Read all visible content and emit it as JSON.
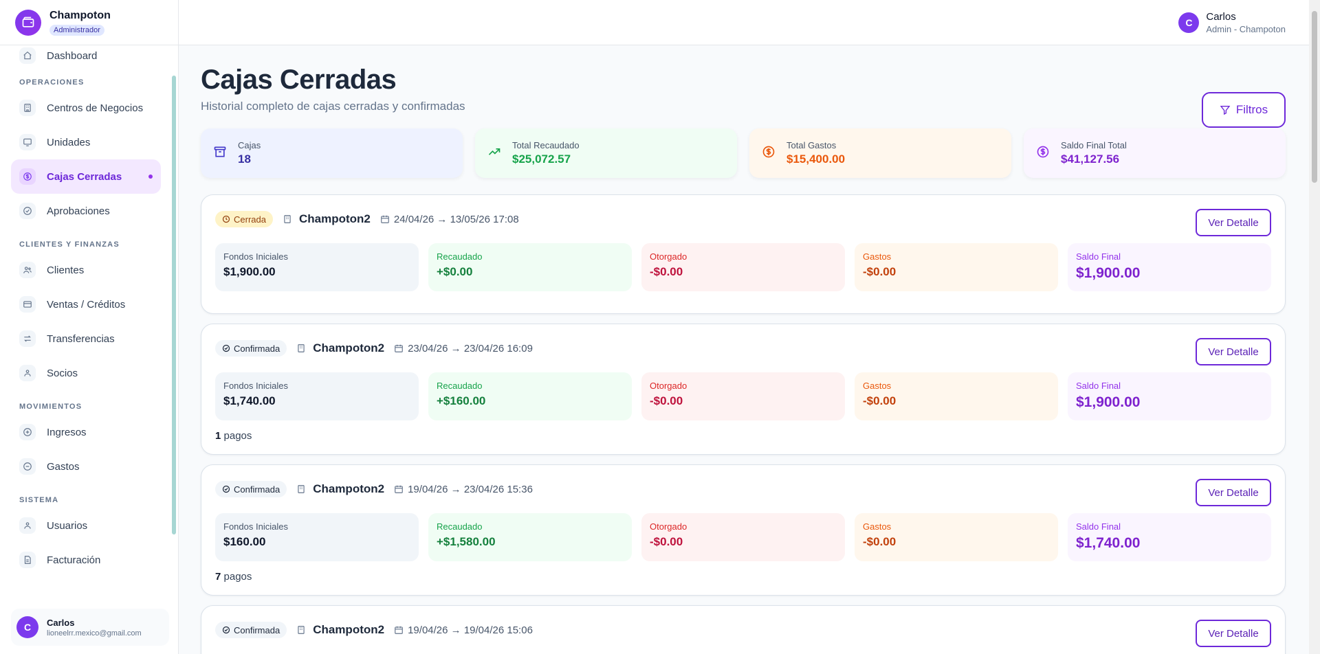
{
  "brand": {
    "name": "Champoton",
    "role": "Administrador"
  },
  "nav": {
    "dashboard": "Dashboard",
    "section_operaciones": "OPERACIONES",
    "centros": "Centros de Negocios",
    "unidades": "Unidades",
    "cajas": "Cajas Cerradas",
    "aprobaciones": "Aprobaciones",
    "section_clientes": "CLIENTES Y FINANZAS",
    "clientes": "Clientes",
    "ventas": "Ventas / Créditos",
    "transferencias": "Transferencias",
    "socios": "Socios",
    "section_movimientos": "MOVIMIENTOS",
    "ingresos": "Ingresos",
    "gastos": "Gastos",
    "section_sistema": "SISTEMA",
    "usuarios": "Usuarios",
    "facturacion": "Facturación"
  },
  "sidebar_user": {
    "initial": "C",
    "name": "Carlos",
    "email": "lioneelrr.mexico@gmail.com"
  },
  "topbar_user": {
    "initial": "C",
    "name": "Carlos",
    "role": "Admin - Champoton"
  },
  "page": {
    "title": "Cajas Cerradas",
    "subtitle": "Historial completo de cajas cerradas y confirmadas",
    "filter_label": "Filtros"
  },
  "summary": {
    "cajas_label": "Cajas",
    "cajas_value": "18",
    "recaudado_label": "Total Recaudado",
    "recaudado_value": "$25,072.57",
    "gastos_label": "Total Gastos",
    "gastos_value": "$15,400.00",
    "saldo_label": "Saldo Final Total",
    "saldo_value": "$41,127.56"
  },
  "labels": {
    "fondos": "Fondos Iniciales",
    "recaudado": "Recaudado",
    "otorgado": "Otorgado",
    "gastos": "Gastos",
    "saldo": "Saldo Final",
    "detail_button": "Ver Detalle",
    "pagos_suffix": "pagos"
  },
  "cajas": [
    {
      "status": "Cerrada",
      "centro": "Champoton2",
      "fecha": "24/04/26 → 13/05/26 17:08",
      "fondos": "$1,900.00",
      "recaudado": "+$0.00",
      "otorgado": "-$0.00",
      "gastos": "-$0.00",
      "saldo": "$1,900.00",
      "pagos": ""
    },
    {
      "status": "Confirmada",
      "centro": "Champoton2",
      "fecha": "23/04/26 → 23/04/26 16:09",
      "fondos": "$1,740.00",
      "recaudado": "+$160.00",
      "otorgado": "-$0.00",
      "gastos": "-$0.00",
      "saldo": "$1,900.00",
      "pagos": "1"
    },
    {
      "status": "Confirmada",
      "centro": "Champoton2",
      "fecha": "19/04/26 → 23/04/26 15:36",
      "fondos": "$160.00",
      "recaudado": "+$1,580.00",
      "otorgado": "-$0.00",
      "gastos": "-$0.00",
      "saldo": "$1,740.00",
      "pagos": "7"
    },
    {
      "status": "Confirmada",
      "centro": "Champoton2",
      "fecha": "19/04/26 → 19/04/26 15:06"
    }
  ],
  "colors": {
    "accent": "#6d28d9",
    "sidebar_scroll": "#a7d6d3"
  }
}
